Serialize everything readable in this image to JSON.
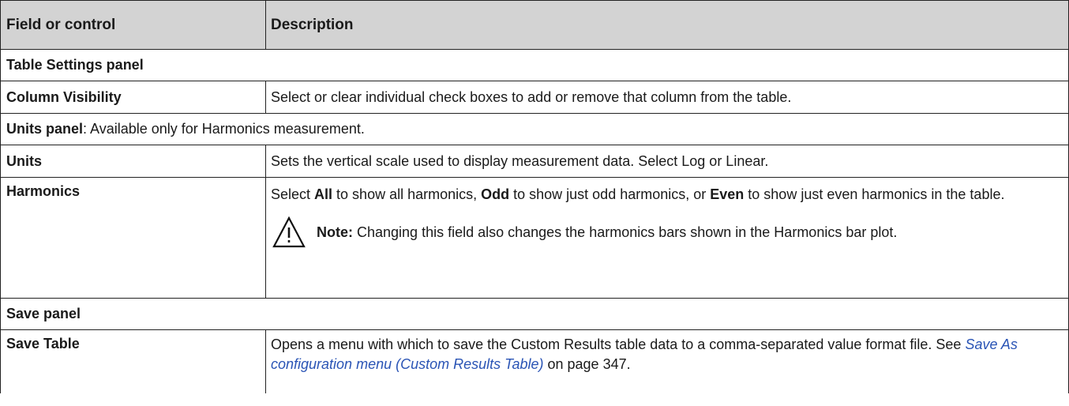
{
  "header": {
    "col1": "Field or control",
    "col2": "Description"
  },
  "sections": {
    "table_settings": "Table Settings panel",
    "units_panel": {
      "label": "Units panel",
      "rest": ": Available only for Harmonics measurement."
    },
    "save_panel": "Save panel"
  },
  "rows": {
    "column_visibility": {
      "field": "Column Visibility",
      "desc": "Select or clear individual check boxes to add or remove that column from the table."
    },
    "units": {
      "field": "Units",
      "desc": "Sets the vertical scale used to display measurement data. Select Log or Linear."
    },
    "harmonics": {
      "field": "Harmonics",
      "p1": "Select ",
      "all": "All",
      "p2": " to show all harmonics, ",
      "odd": "Odd",
      "p3": " to show just odd harmonics, or ",
      "even": "Even",
      "p4": " to show just even harmonics in the table.",
      "note_label": "Note:",
      "note_text": " Changing this field also changes the harmonics bars shown in the Harmonics bar plot.",
      "note_icon": "warning-triangle-icon"
    },
    "save_table": {
      "field": "Save Table",
      "desc1": "Opens a menu with which to save the Custom Results table data to a comma-separated value format file. See ",
      "link": "Save As configuration menu (Custom Results Table)",
      "desc2": " on page 347."
    }
  },
  "colors": {
    "header_bg": "#d3d3d3",
    "link": "#2a54b5",
    "border": "#222222"
  }
}
